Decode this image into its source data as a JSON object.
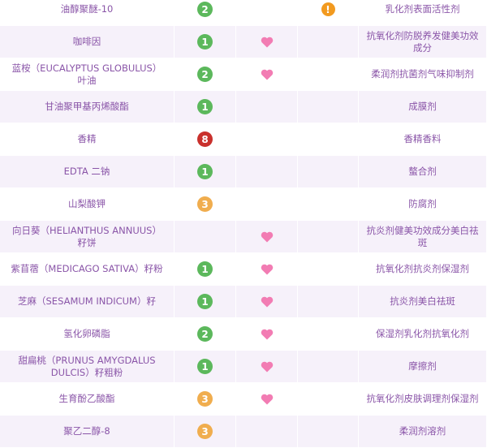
{
  "colors": {
    "score_1": "#5cb85c",
    "score_2": "#5cb85c",
    "score_3": "#f0ad4e",
    "score_8": "#c9302c",
    "heart": "#f27cb3",
    "warning": "#f29a1f"
  },
  "icons": {
    "active": "heart-icon",
    "acne_risk": "warning-icon"
  },
  "rows": [
    {
      "name": "油醇聚醚-10",
      "score": "2",
      "active": false,
      "acne_risk": true,
      "purpose": "乳化剂表面活性剂"
    },
    {
      "name": "咖啡因",
      "score": "1",
      "active": true,
      "acne_risk": false,
      "purpose": "抗氧化剂防脱养发健美功效成分"
    },
    {
      "name": "蓝桉（EUCALYPTUS GLOBULUS）叶油",
      "score": "2",
      "active": true,
      "acne_risk": false,
      "purpose": "柔润剂抗菌剂气味抑制剂"
    },
    {
      "name": "甘油聚甲基丙烯酸酯",
      "score": "1",
      "active": false,
      "acne_risk": false,
      "purpose": "成膜剂"
    },
    {
      "name": "香精",
      "score": "8",
      "active": false,
      "acne_risk": false,
      "purpose": "香精香料"
    },
    {
      "name": "EDTA 二钠",
      "score": "1",
      "active": false,
      "acne_risk": false,
      "purpose": "螯合剂"
    },
    {
      "name": "山梨酸钾",
      "score": "3",
      "active": false,
      "acne_risk": false,
      "purpose": "防腐剂"
    },
    {
      "name": "向日葵（HELIANTHUS ANNUUS）籽饼",
      "score": "",
      "active": true,
      "acne_risk": false,
      "purpose": "抗炎剂健美功效成分美白祛斑"
    },
    {
      "name": "紫苜蓿（MEDICAGO SATIVA）籽粉",
      "score": "1",
      "active": true,
      "acne_risk": false,
      "purpose": "抗氧化剂抗炎剂保湿剂"
    },
    {
      "name": "芝麻（SESAMUM INDICUM）籽",
      "score": "1",
      "active": true,
      "acne_risk": false,
      "purpose": "抗炎剂美白祛斑"
    },
    {
      "name": "氢化卵磷脂",
      "score": "2",
      "active": true,
      "acne_risk": false,
      "purpose": "保湿剂乳化剂抗氧化剂"
    },
    {
      "name": "甜扁桃（PRUNUS AMYGDALUS DULCIS）籽粗粉",
      "score": "1",
      "active": true,
      "acne_risk": false,
      "purpose": "摩擦剂"
    },
    {
      "name": "生育酚乙酸酯",
      "score": "3",
      "active": true,
      "acne_risk": false,
      "purpose": "抗氧化剂皮肤调理剂保湿剂"
    },
    {
      "name": "聚乙二醇-8",
      "score": "3",
      "active": false,
      "acne_risk": false,
      "purpose": "柔润剂溶剂"
    }
  ]
}
